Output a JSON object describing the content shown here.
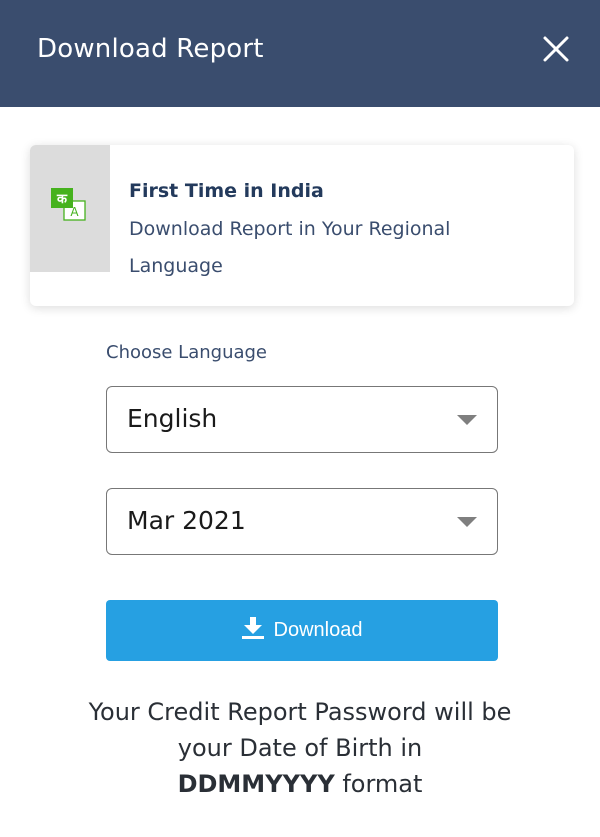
{
  "header": {
    "title": "Download Report",
    "close_icon": "close-icon"
  },
  "banner": {
    "icon": "translate-icon",
    "icon_glyph_primary": "क",
    "icon_glyph_secondary": "A",
    "title": "First Time in India",
    "description": "Download Report in Your Regional Language"
  },
  "form": {
    "language_label": "Choose Language",
    "language_selected": "English",
    "period_selected": "Mar 2021"
  },
  "download": {
    "label": "Download",
    "icon": "download-icon"
  },
  "note": {
    "prefix": "Your Credit Report Password will be your Date of Birth in",
    "format": "DDMMYYYY",
    "suffix": "format"
  },
  "colors": {
    "header_bg": "#3a4d6e",
    "button_bg": "#26a0e2",
    "icon_green": "#46b21e"
  }
}
